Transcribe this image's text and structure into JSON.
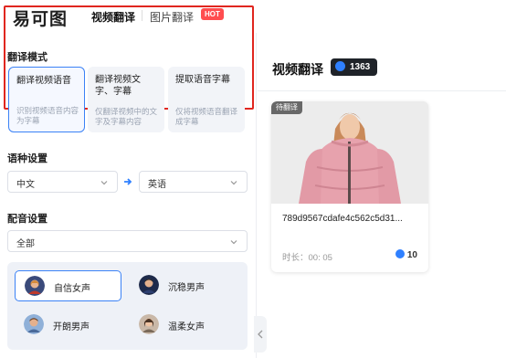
{
  "app": {
    "logo_text": "易可图"
  },
  "nav": {
    "video_translate": "视频翻译",
    "image_translate": "图片翻译",
    "hot_badge": "HOT"
  },
  "translate_mode": {
    "title": "翻译模式",
    "cards": [
      {
        "title": "翻译视频语音",
        "desc": "识别视频语音内容为字幕",
        "selected": true
      },
      {
        "title": "翻译视频文字、字幕",
        "desc": "仅翻译视频中的文字及字幕内容",
        "selected": false
      },
      {
        "title": "提取语音字幕",
        "desc": "仅将视频语音翻译成字幕",
        "selected": false
      }
    ]
  },
  "language": {
    "title": "语种设置",
    "source": "中文",
    "target": "英语"
  },
  "dubbing": {
    "title": "配音设置",
    "filter": "全部",
    "voices": [
      {
        "name": "自信女声",
        "selected": true
      },
      {
        "name": "沉稳男声",
        "selected": false
      },
      {
        "name": "开朗男声",
        "selected": false
      },
      {
        "name": "温柔女声",
        "selected": false
      }
    ]
  },
  "right": {
    "title": "视频翻译",
    "credits": "1363",
    "card": {
      "status": "待翻译",
      "name": "789d9567cdafe4c562c5d31...",
      "duration": "时长：00: 05",
      "cost": "10"
    }
  },
  "colors": {
    "accent": "#3b82f6",
    "highlight_border": "#e0261f",
    "hot": "#ff4d4f",
    "coin": "#2f80ff"
  }
}
